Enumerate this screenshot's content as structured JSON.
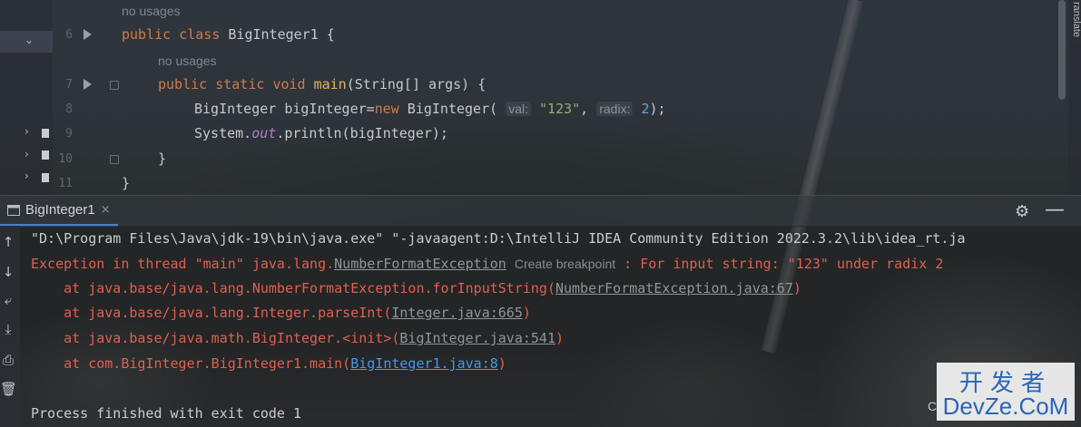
{
  "editor": {
    "usages_1": "no usages",
    "usages_2": "no usages",
    "lines": [
      {
        "no": "6"
      },
      {
        "no": "7"
      },
      {
        "no": "8"
      },
      {
        "no": "9"
      },
      {
        "no": "10"
      },
      {
        "no": "11"
      }
    ],
    "l6": {
      "kw1": "public",
      "kw2": "class",
      "name": "BigInteger1",
      "rest": " {"
    },
    "l7": {
      "kw1": "public",
      "kw2": "static",
      "kw3": "void",
      "fn": "main",
      "rest": "(String[] args) {"
    },
    "l8": {
      "pre": "BigInteger bigInteger=",
      "kw": "new",
      "cls": " BigInteger(",
      "hint1": "val:",
      "str": "\"123\"",
      "sep": ",",
      "hint2": "radix:",
      "num": "2",
      "end": ");"
    },
    "l9": {
      "pre": "System.",
      "field": "out",
      "rest": ".println(bigInteger);"
    },
    "l10": {
      "text": "}"
    },
    "l11": {
      "text": "}"
    },
    "side_label": "ranslate"
  },
  "run": {
    "tab_label": "BigInteger1",
    "tab_close": "×",
    "settings_icon": "gear-icon",
    "minimize_icon": "minus-icon",
    "console": {
      "cmd": "\"D:\\Program Files\\Java\\jdk-19\\bin\\java.exe\" \"-javaagent:D:\\IntelliJ IDEA Community Edition 2022.3.2\\lib\\idea_rt.ja",
      "exc_prefix": "Exception in thread \"main\" java.lang.",
      "exc_class": "NumberFormatException",
      "exc_hint": "Create breakpoint",
      "exc_msg": " : For input string: \"123\" under radix 2",
      "st1_pre": "    at java.base/java.lang.NumberFormatException.forInputString(",
      "st1_link": "NumberFormatException.java:67",
      "st2_pre": "    at java.base/java.lang.Integer.parseInt(",
      "st2_link": "Integer.java:665",
      "st3_pre": "    at java.base/java.math.BigInteger.<init>(",
      "st3_link": "BigInteger.java:541",
      "st4_pre": "    at com.BigInteger.BigInteger1.main(",
      "st4_link": "BigInteger1.java:8",
      "close_paren": ")",
      "exit": "Process finished with exit code 1"
    }
  },
  "watermark": {
    "top": "开发者",
    "bottom": "DevZe.CoM",
    "left_char": "C"
  },
  "colors": {
    "keyword": "#ce7b4a",
    "function": "#e3b55c",
    "string": "#8fb06a",
    "number": "#5fa8c8",
    "error": "#e0604e",
    "link": "#4d95e6",
    "tab_underline": "#4b7fc4"
  }
}
